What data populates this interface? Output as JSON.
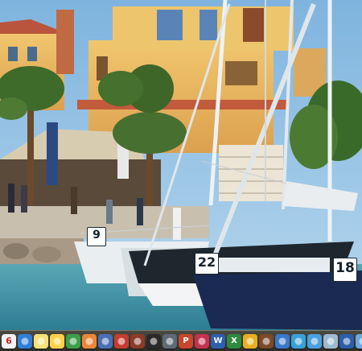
{
  "wallpaper": {
    "berth_numbers": [
      "9",
      "22",
      "18"
    ]
  },
  "dock": {
    "items": [
      {
        "icon": "calendar-icon",
        "text": "6",
        "color": "#f2f2f2"
      },
      {
        "icon": "safari-icon",
        "text": "",
        "color": "#2f7fd8"
      },
      {
        "icon": "notes-icon",
        "text": "",
        "color": "#f4e27a"
      },
      {
        "icon": "photos-icon",
        "text": "",
        "color": "#ffd24a"
      },
      {
        "icon": "chrome-icon",
        "text": "",
        "color": "#3c9e4a"
      },
      {
        "icon": "messages-icon",
        "text": "",
        "color": "#e8873a"
      },
      {
        "icon": "mail-icon",
        "text": "",
        "color": "#4a6fb5"
      },
      {
        "icon": "film-icon",
        "text": "",
        "color": "#c43b2f"
      },
      {
        "icon": "photo-booth-icon",
        "text": "",
        "color": "#8c3a2a"
      },
      {
        "icon": "disk-utility-icon",
        "text": "",
        "color": "#2a2a2a"
      },
      {
        "icon": "utility-icon",
        "text": "",
        "color": "#5f6a75"
      },
      {
        "icon": "ppt-icon",
        "text": "P",
        "color": "#c9462c"
      },
      {
        "icon": "cleaner-icon",
        "text": "",
        "color": "#c43252"
      },
      {
        "icon": "word-icon",
        "text": "W",
        "color": "#2f5fb0"
      },
      {
        "icon": "excel-icon",
        "text": "X",
        "color": "#2e8a3e"
      },
      {
        "icon": "itunes-icon",
        "text": "",
        "color": "#e8b020"
      },
      {
        "icon": "book-icon",
        "text": "",
        "color": "#7a4a2a"
      },
      {
        "icon": "globe-icon",
        "text": "",
        "color": "#3a78c8"
      },
      {
        "icon": "numbers-icon",
        "text": "",
        "color": "#3aa0d8"
      },
      {
        "icon": "dashboard-icon",
        "text": "",
        "color": "#4aa0e0"
      },
      {
        "icon": "chart-icon",
        "text": "",
        "color": "#9fb9d0"
      },
      {
        "icon": "xcode-icon",
        "text": "",
        "color": "#2b5faa"
      },
      {
        "icon": "app-store-icon",
        "text": "",
        "color": "#6fa8e0"
      },
      {
        "icon": "trash-icon",
        "text": "",
        "color": "#d9d9d9"
      }
    ]
  }
}
